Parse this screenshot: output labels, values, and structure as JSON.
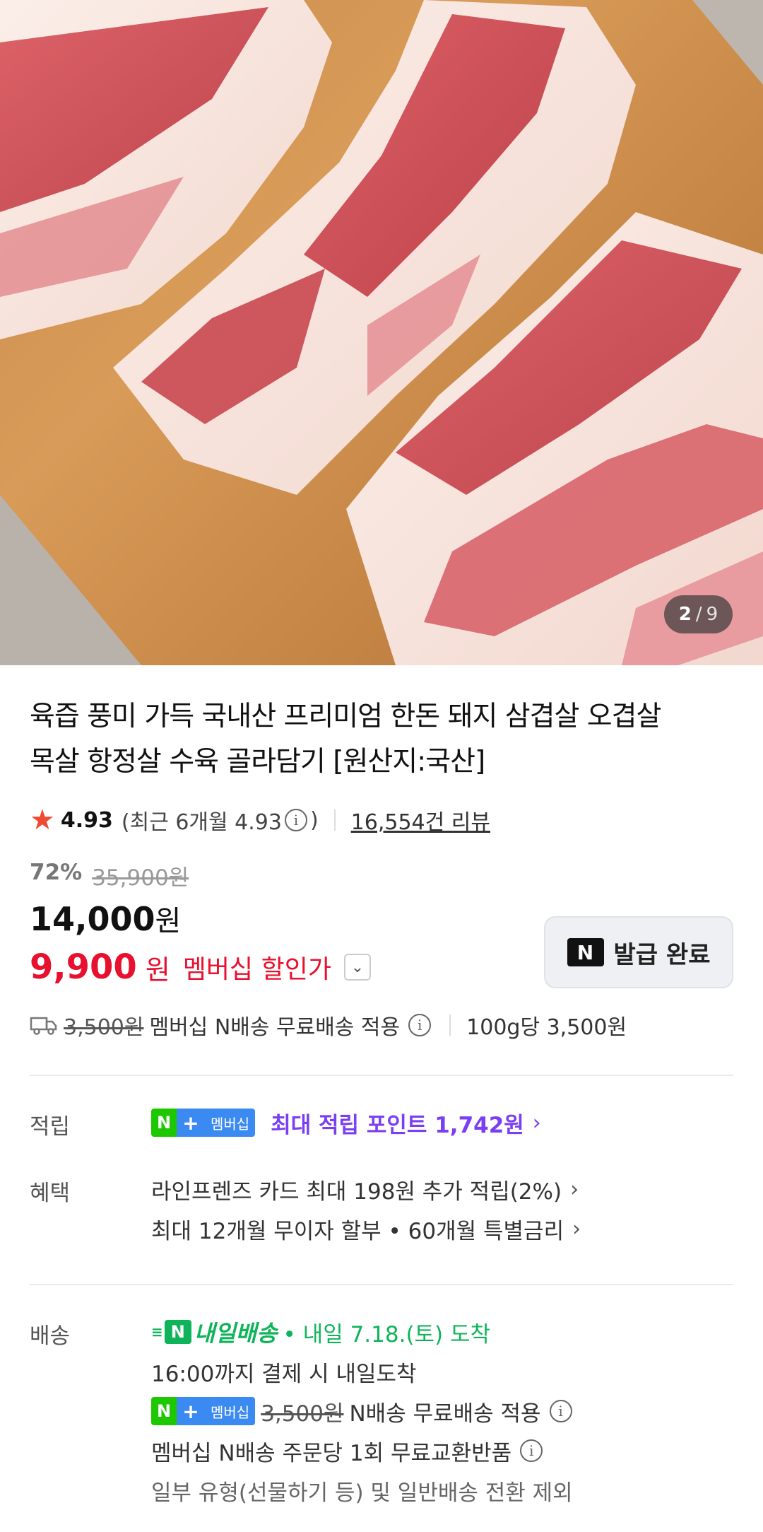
{
  "gallery": {
    "current": "2",
    "separator": "/",
    "total": "9",
    "image_alt": "돼지 삼겹살 상품 이미지"
  },
  "product": {
    "title_line1": "육즙 풍미 가득 국내산 프리미엄 한돈 돼지 삼겹살 오겹살",
    "title_line2": "목살 항정살 수육 골라담기 [원산지:국산]",
    "rating_score": "4.93",
    "rating_recent_prefix": "(최근 6개월 4.93",
    "rating_recent_suffix": ")",
    "review_count": "16,554건 리뷰",
    "discount_pct": "72%",
    "original_price": "35,900원",
    "price_amount": "14,000",
    "price_unit": "원",
    "member_price_amount": "9,900",
    "member_price_unit": "원",
    "member_price_label": "멤버십 할인가",
    "coupon_button_label": "발급 완료",
    "coupon_badge": "N"
  },
  "shipping_summary": {
    "original_fee": "3,500원",
    "text": "멤버십 N배송 무료배송 적용",
    "unit_price": "100g당 3,500원"
  },
  "sections": {
    "points_label": "적립",
    "points_badge_n": "N",
    "points_badge_plus": "+",
    "points_badge_text": "멤버십",
    "points_text": "최대 적립 포인트 1,742원",
    "benefit_label": "혜택",
    "benefit_line1": "라인프렌즈 카드 최대 198원 추가 적립(2%)",
    "benefit_line2": "최대 12개월 무이자 할부 • 60개월 특별금리",
    "delivery_label": "배송",
    "delivery_logo_n": "N",
    "delivery_logo_text": "내일배송",
    "delivery_eta": "• 내일 7.18.(토) 도착",
    "delivery_cutoff": "16:00까지 결제 시 내일도착",
    "delivery_fee_original": "3,500원",
    "delivery_fee_text": "N배송 무료배송 적용",
    "delivery_exchange": "멤버십 N배송 주문당 1회 무료교환반품",
    "delivery_exclusion": "일부 유형(선물하기 등) 및 일반배송 전환 제외"
  },
  "colors": {
    "accent_red": "#e8102f",
    "star": "#f04a32",
    "points_purple": "#7a3ff2",
    "delivery_green": "#0fb45a",
    "naver_green": "#1ec800",
    "membership_blue": "#3a8af2"
  }
}
